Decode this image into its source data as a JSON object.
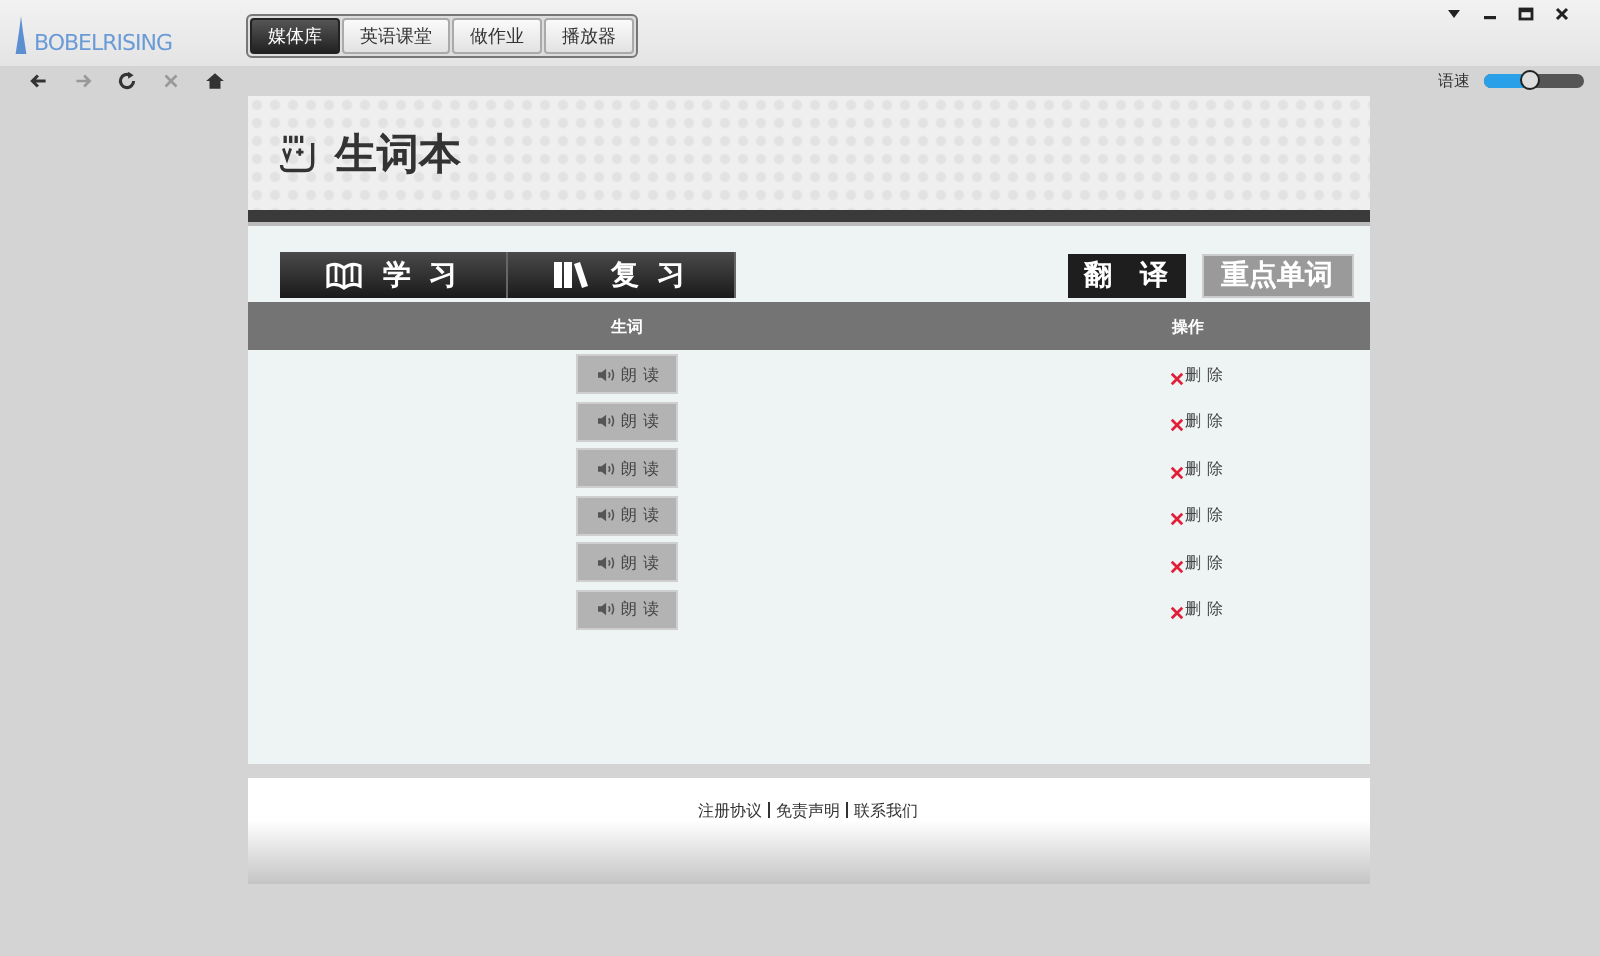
{
  "app": {
    "logo_text": "BOBELRISING"
  },
  "nav_tabs": [
    {
      "label": "媒体库",
      "selected": true
    },
    {
      "label": "英语课堂",
      "selected": false
    },
    {
      "label": "做作业",
      "selected": false
    },
    {
      "label": "播放器",
      "selected": false
    }
  ],
  "speed": {
    "label": "语速",
    "level": 0.45
  },
  "page": {
    "title": "生词本"
  },
  "mode_buttons": [
    {
      "label": "学 习",
      "kind": "study"
    },
    {
      "label": "复 习",
      "kind": "review"
    }
  ],
  "tool_buttons": [
    {
      "label": "翻　译",
      "kind": "dark"
    },
    {
      "label": "重点单词",
      "kind": "light"
    }
  ],
  "table": {
    "columns": [
      "生词",
      "操作"
    ],
    "rows": [
      {
        "read": "朗 读",
        "delete": "删 除"
      },
      {
        "read": "朗 读",
        "delete": "删 除"
      },
      {
        "read": "朗 读",
        "delete": "删 除"
      },
      {
        "read": "朗 读",
        "delete": "删 除"
      },
      {
        "read": "朗 读",
        "delete": "删 除"
      },
      {
        "read": "朗 读",
        "delete": "删 除"
      }
    ]
  },
  "footer": {
    "links": [
      "注册协议",
      "免责声明",
      "联系我们"
    ]
  }
}
